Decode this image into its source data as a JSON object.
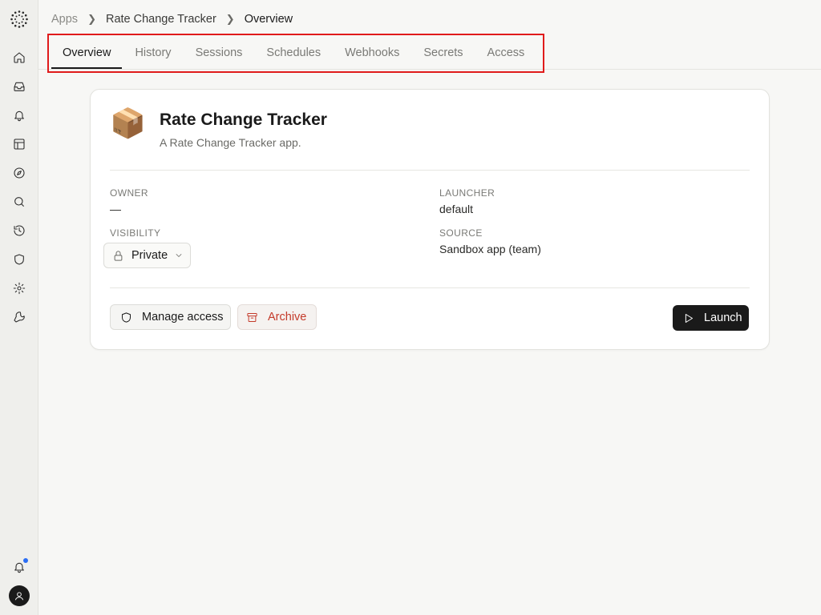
{
  "breadcrumb": {
    "root": "Apps",
    "app": "Rate Change Tracker",
    "current": "Overview"
  },
  "tabs": [
    {
      "label": "Overview",
      "active": true
    },
    {
      "label": "History",
      "active": false
    },
    {
      "label": "Sessions",
      "active": false
    },
    {
      "label": "Schedules",
      "active": false
    },
    {
      "label": "Webhooks",
      "active": false
    },
    {
      "label": "Secrets",
      "active": false
    },
    {
      "label": "Access",
      "active": false
    }
  ],
  "app": {
    "emoji": "📦",
    "title": "Rate Change Tracker",
    "description": "A Rate Change Tracker app."
  },
  "fields": {
    "owner_label": "OWNER",
    "owner_value": "—",
    "launcher_label": "LAUNCHER",
    "launcher_value": "default",
    "visibility_label": "VISIBILITY",
    "visibility_value": "Private",
    "source_label": "SOURCE",
    "source_value": "Sandbox app (team)"
  },
  "actions": {
    "manage_access": "Manage access",
    "archive": "Archive",
    "launch": "Launch"
  },
  "sidebar": {
    "icons": [
      "home-icon",
      "inbox-icon",
      "bell-icon",
      "layout-icon",
      "compass-icon",
      "search-icon",
      "history-icon",
      "shield-icon",
      "gear-icon",
      "wrench-icon"
    ],
    "notification_icon": "bell-icon",
    "avatar_icon": "user-icon"
  },
  "colors": {
    "accent": "#1a1a1a",
    "danger": "#c43a2a",
    "highlight": "#e01b1b",
    "notification_dot": "#2a6df4"
  }
}
